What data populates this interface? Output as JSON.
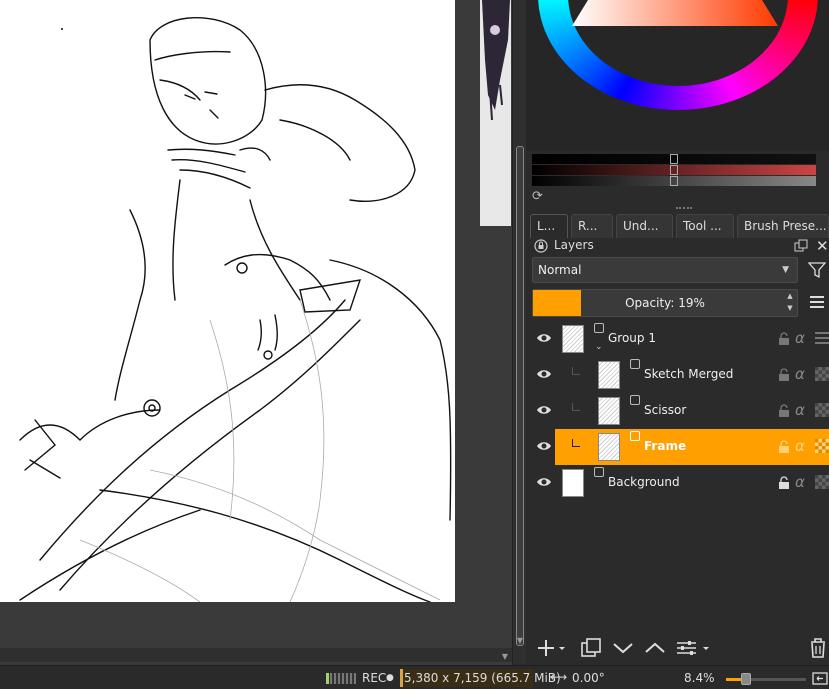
{
  "dock": {
    "tabs": [
      {
        "label": "L..."
      },
      {
        "label": "R..."
      },
      {
        "label": "Und..."
      },
      {
        "label": "Tool ..."
      },
      {
        "label": "Brush Prese..."
      }
    ],
    "layers_title": "Layers",
    "blend_mode": "Normal",
    "opacity_label": "Opacity:  19%",
    "opacity_value": 0.19,
    "accent_color": "#ff9f00"
  },
  "layers": [
    {
      "name": "Group 1",
      "type": "group",
      "selected": false
    },
    {
      "name": "Sketch Merged",
      "type": "paint",
      "selected": false
    },
    {
      "name": "Scissor",
      "type": "paint",
      "selected": false
    },
    {
      "name": "Frame",
      "type": "paint",
      "selected": true
    },
    {
      "name": "Background",
      "type": "paint",
      "selected": false,
      "locked": true
    }
  ],
  "status": {
    "rec_label": "REC",
    "dimensions": "5,380 x 7,159 (665.7 MiB)",
    "rotation": "0.00°",
    "zoom": "8.4%",
    "zoom_level": 0.12
  },
  "icons": {
    "eye": "eye-icon",
    "lock": "lock-icon",
    "alpha": "alpha-lock-icon",
    "add": "add-layer-icon",
    "duplicate": "duplicate-layer-icon",
    "move_down": "chevron-down-icon",
    "move_up": "chevron-up-icon",
    "properties": "layer-properties-icon",
    "delete": "trash-icon"
  }
}
